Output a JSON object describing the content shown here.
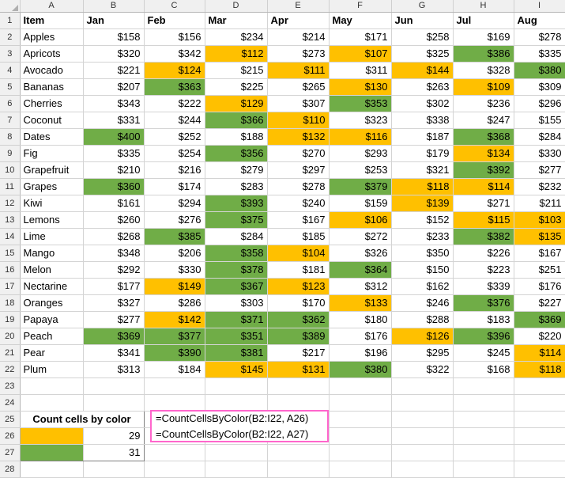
{
  "spreadsheet": {
    "column_letters": [
      "A",
      "B",
      "C",
      "D",
      "E",
      "F",
      "G",
      "H",
      "I"
    ],
    "row_numbers": [
      1,
      2,
      3,
      4,
      5,
      6,
      7,
      8,
      9,
      10,
      11,
      12,
      13,
      14,
      15,
      16,
      17,
      18,
      19,
      20,
      21,
      22,
      23,
      24,
      25,
      26,
      27,
      28
    ],
    "headers": [
      "Item",
      "Jan",
      "Feb",
      "Mar",
      "Apr",
      "May",
      "Jun",
      "Jul",
      "Aug"
    ],
    "colors": {
      "orange": "#FFC000",
      "green": "#70AD47",
      "callout_border": "#FF66CC",
      "header_strip": "#f0f0f0",
      "gridline": "#d4d4d4"
    },
    "rows": [
      {
        "item": "Apples",
        "values": [
          "$158",
          "$156",
          "$234",
          "$214",
          "$171",
          "$258",
          "$169",
          "$278"
        ],
        "fills": [
          "",
          "",
          "",
          "",
          "",
          "",
          "",
          ""
        ]
      },
      {
        "item": "Apricots",
        "values": [
          "$320",
          "$342",
          "$112",
          "$273",
          "$107",
          "$325",
          "$386",
          "$335"
        ],
        "fills": [
          "",
          "",
          "orange",
          "",
          "orange",
          "",
          "green",
          ""
        ]
      },
      {
        "item": "Avocado",
        "values": [
          "$221",
          "$124",
          "$215",
          "$111",
          "$311",
          "$144",
          "$328",
          "$380"
        ],
        "fills": [
          "",
          "orange",
          "",
          "orange",
          "",
          "orange",
          "",
          "green"
        ]
      },
      {
        "item": "Bananas",
        "values": [
          "$207",
          "$363",
          "$225",
          "$265",
          "$130",
          "$263",
          "$109",
          "$309"
        ],
        "fills": [
          "",
          "green",
          "",
          "",
          "orange",
          "",
          "orange",
          ""
        ]
      },
      {
        "item": "Cherries",
        "values": [
          "$343",
          "$222",
          "$129",
          "$307",
          "$353",
          "$302",
          "$236",
          "$296"
        ],
        "fills": [
          "",
          "",
          "orange",
          "",
          "green",
          "",
          "",
          ""
        ]
      },
      {
        "item": "Coconut",
        "values": [
          "$331",
          "$244",
          "$366",
          "$110",
          "$323",
          "$338",
          "$247",
          "$155"
        ],
        "fills": [
          "",
          "",
          "green",
          "orange",
          "",
          "",
          "",
          ""
        ]
      },
      {
        "item": "Dates",
        "values": [
          "$400",
          "$252",
          "$188",
          "$132",
          "$116",
          "$187",
          "$368",
          "$284"
        ],
        "fills": [
          "green",
          "",
          "",
          "orange",
          "orange",
          "",
          "green",
          ""
        ]
      },
      {
        "item": "Fig",
        "values": [
          "$335",
          "$254",
          "$356",
          "$270",
          "$293",
          "$179",
          "$134",
          "$330"
        ],
        "fills": [
          "",
          "",
          "green",
          "",
          "",
          "",
          "orange",
          ""
        ]
      },
      {
        "item": "Grapefruit",
        "values": [
          "$210",
          "$216",
          "$279",
          "$297",
          "$253",
          "$321",
          "$392",
          "$277"
        ],
        "fills": [
          "",
          "",
          "",
          "",
          "",
          "",
          "green",
          ""
        ]
      },
      {
        "item": "Grapes",
        "values": [
          "$360",
          "$174",
          "$283",
          "$278",
          "$379",
          "$118",
          "$114",
          "$232"
        ],
        "fills": [
          "green",
          "",
          "",
          "",
          "green",
          "orange",
          "orange",
          ""
        ]
      },
      {
        "item": "Kiwi",
        "values": [
          "$161",
          "$294",
          "$393",
          "$240",
          "$159",
          "$139",
          "$271",
          "$211"
        ],
        "fills": [
          "",
          "",
          "green",
          "",
          "",
          "orange",
          "",
          ""
        ]
      },
      {
        "item": "Lemons",
        "values": [
          "$260",
          "$276",
          "$375",
          "$167",
          "$106",
          "$152",
          "$115",
          "$103"
        ],
        "fills": [
          "",
          "",
          "green",
          "",
          "orange",
          "",
          "orange",
          "orange"
        ]
      },
      {
        "item": "Lime",
        "values": [
          "$268",
          "$385",
          "$284",
          "$185",
          "$272",
          "$233",
          "$382",
          "$135"
        ],
        "fills": [
          "",
          "green",
          "",
          "",
          "",
          "",
          "green",
          "orange"
        ]
      },
      {
        "item": "Mango",
        "values": [
          "$348",
          "$206",
          "$358",
          "$104",
          "$326",
          "$350",
          "$226",
          "$167"
        ],
        "fills": [
          "",
          "",
          "green",
          "orange",
          "",
          "",
          "",
          ""
        ]
      },
      {
        "item": "Melon",
        "values": [
          "$292",
          "$330",
          "$378",
          "$181",
          "$364",
          "$150",
          "$223",
          "$251"
        ],
        "fills": [
          "",
          "",
          "green",
          "",
          "green",
          "",
          "",
          ""
        ]
      },
      {
        "item": "Nectarine",
        "values": [
          "$177",
          "$149",
          "$367",
          "$123",
          "$312",
          "$162",
          "$339",
          "$176"
        ],
        "fills": [
          "",
          "orange",
          "green",
          "orange",
          "",
          "",
          "",
          ""
        ]
      },
      {
        "item": "Oranges",
        "values": [
          "$327",
          "$286",
          "$303",
          "$170",
          "$133",
          "$246",
          "$376",
          "$227"
        ],
        "fills": [
          "",
          "",
          "",
          "",
          "orange",
          "",
          "green",
          ""
        ]
      },
      {
        "item": "Papaya",
        "values": [
          "$277",
          "$142",
          "$371",
          "$362",
          "$180",
          "$288",
          "$183",
          "$369"
        ],
        "fills": [
          "",
          "orange",
          "green",
          "green",
          "",
          "",
          "",
          "green"
        ]
      },
      {
        "item": "Peach",
        "values": [
          "$369",
          "$377",
          "$351",
          "$389",
          "$176",
          "$126",
          "$396",
          "$220"
        ],
        "fills": [
          "green",
          "green",
          "green",
          "green",
          "",
          "orange",
          "green",
          ""
        ]
      },
      {
        "item": "Pear",
        "values": [
          "$341",
          "$390",
          "$381",
          "$217",
          "$196",
          "$295",
          "$245",
          "$114"
        ],
        "fills": [
          "",
          "green",
          "green",
          "",
          "",
          "",
          "",
          "orange"
        ]
      },
      {
        "item": "Plum",
        "values": [
          "$313",
          "$184",
          "$145",
          "$131",
          "$380",
          "$322",
          "$168",
          "$118"
        ],
        "fills": [
          "",
          "",
          "orange",
          "orange",
          "green",
          "",
          "",
          "orange"
        ]
      }
    ]
  },
  "count_by_color": {
    "title": "Count cells by color",
    "entries": [
      {
        "swatch": "orange",
        "count": "29",
        "formula": "=CountCellsByColor(B2:I22, A26)"
      },
      {
        "swatch": "green",
        "count": "31",
        "formula": "=CountCellsByColor(B2:I22, A27)"
      }
    ]
  }
}
